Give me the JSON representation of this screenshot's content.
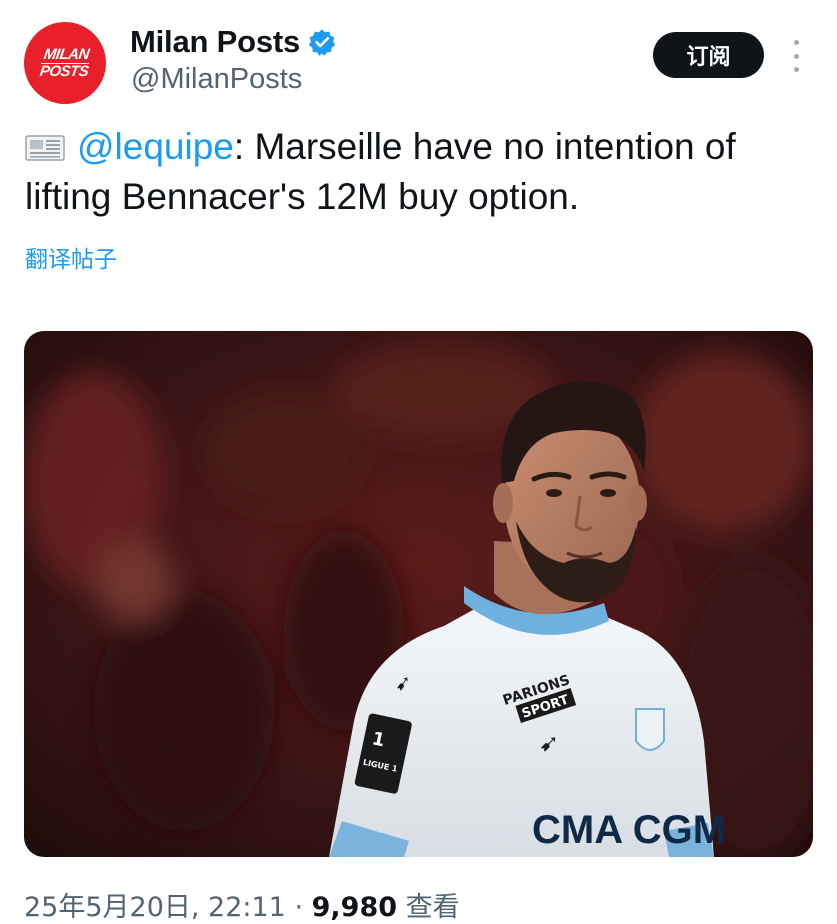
{
  "account": {
    "display_name": "Milan Posts",
    "handle": "@MilanPosts",
    "avatar_line1": "MILAN",
    "avatar_line2": "POSTS",
    "verified": true
  },
  "actions": {
    "subscribe_label": "订阅"
  },
  "tweet": {
    "mention": "@lequipe",
    "text": ": Marseille have no intention of lifting Bennacer's 12M buy option.",
    "translate_label": "翻译帖子"
  },
  "media": {
    "jersey_sponsor": "CMA CGM",
    "sleeve_sponsor_line1": "PARIONS",
    "sleeve_sponsor_line2": "SPORT",
    "league_patch": "LIGUE 1"
  },
  "meta": {
    "timestamp": "25年5月20日, 22:11",
    "separator": " · ",
    "views_count": "9,980",
    "views_label": " 查看"
  },
  "colors": {
    "accent": "#1d9bf0",
    "text_primary": "#0f1419",
    "text_secondary": "#536471",
    "avatar_bg": "#e8202a",
    "button_bg": "#0f1419"
  }
}
